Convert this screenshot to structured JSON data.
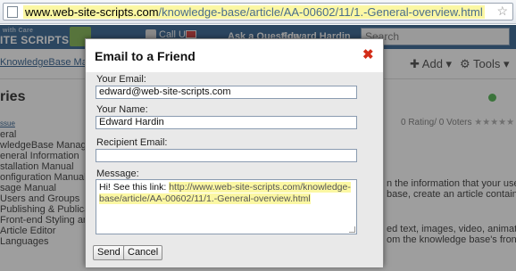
{
  "browser": {
    "url_domain": "www.web-site-scripts.com",
    "url_path": "/knowledge-base/article/AA-00602/11/1.-General-overview.html"
  },
  "page": {
    "logo": "ITE SCRIPTS",
    "logo_tag": "with Care",
    "call_us": "Call Us:",
    "ask_question": "Ask a Question",
    "user_name": "Edward Hardin",
    "search_placeholder": "Search",
    "breadcrumb": "KnowledgeBase Manag",
    "add_label": "Add",
    "tools_label": "Tools",
    "category_title": "ries",
    "rating_text": "0 Rating/ 0 Voters",
    "sidebar": {
      "header": "ssue",
      "items": [
        "eral",
        "wledgeBase Manager F",
        "eneral Information",
        "stallation Manual",
        "onfiguration Manual",
        "sage Manual",
        "Users and Groups",
        "Publishing & Publication",
        "Front-end Styling and Se",
        "Article Editor",
        "Languages"
      ]
    },
    "body_lines": [
      "n the information that your users",
      "base, create an article containing",
      "ed text, images, video, animation",
      "om the knowledge base's front"
    ]
  },
  "dialog": {
    "title": "Email to a Friend",
    "your_email_label": "Your Email:",
    "your_email_value": "edward@web-site-scripts.com",
    "your_name_label": "Your Name:",
    "your_name_value": "Edward Hardin",
    "recipient_label": "Recipient Email:",
    "recipient_value": "",
    "message_label": "Message:",
    "message_prefix": "Hi!  See this link: ",
    "message_link": "http://www.web-site-scripts.com/knowledge-base/article/AA-00602/11/1.-General-overview.html",
    "send_label": "Send",
    "cancel_label": "Cancel"
  }
}
